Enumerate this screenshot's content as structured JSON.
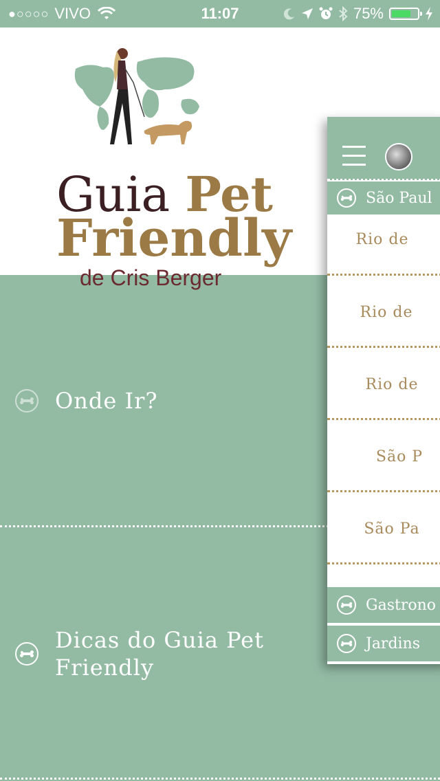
{
  "status_bar": {
    "signal": "●○○○○",
    "carrier": "VIVO",
    "time": "11:07",
    "battery": "75%",
    "battery_level": 0.75,
    "icons": [
      "wifi-icon",
      "moon-icon",
      "location-icon",
      "alarm-icon",
      "bluetooth-icon",
      "charging-icon"
    ]
  },
  "logo": {
    "word1": "Guia",
    "word2": "Pet",
    "word3": "Friendly",
    "byline": "de Cris Berger"
  },
  "menu": {
    "items": [
      {
        "label": "Onde Ir?",
        "icon": "bone-icon"
      },
      {
        "label": "Dicas do Guia Pet Friendly",
        "icon": "bone-icon"
      }
    ]
  },
  "panel": {
    "header": "São Paul",
    "cities": [
      "Rio de",
      "Rio de",
      "Rio de",
      "São P",
      "São Pa"
    ],
    "categories": [
      "Gastrono",
      "Jardins"
    ]
  },
  "colors": {
    "background": "#93bba4",
    "brown": "#9b7a45",
    "dark": "#3b1f22",
    "battery": "#4cd964"
  }
}
